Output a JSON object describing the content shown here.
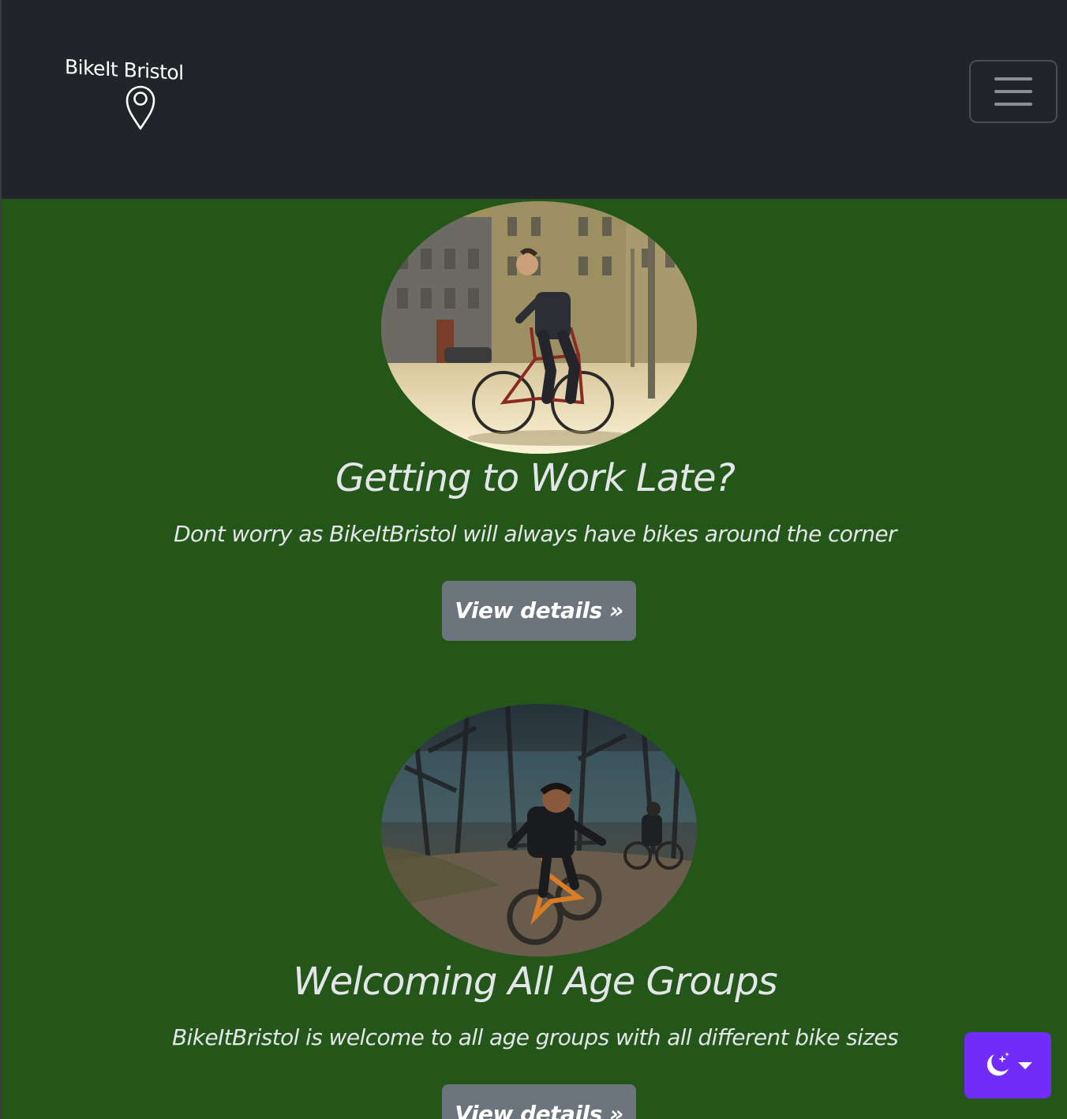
{
  "navbar": {
    "brand_text": "BikeIt Bristol",
    "toggler_label": "Toggle navigation"
  },
  "features": [
    {
      "title": "Getting to Work Late?",
      "text": "Dont worry as BikeItBristol will always have bikes around the corner",
      "button_label": "View details »",
      "image": "man-riding-bicycle-city-street"
    },
    {
      "title": "Welcoming All Age Groups",
      "text": "BikeItBristol is welcome to all age groups with all different bike sizes",
      "button_label": "View details »",
      "image": "child-riding-orange-bike-park"
    }
  ],
  "theme_toggle": {
    "icon": "moon-stars-icon",
    "accent": "#712cf9"
  },
  "colors": {
    "navbar_bg": "#212529",
    "page_bg": "#245519",
    "button_bg": "#6c757d",
    "text": "#e3e6e8"
  }
}
